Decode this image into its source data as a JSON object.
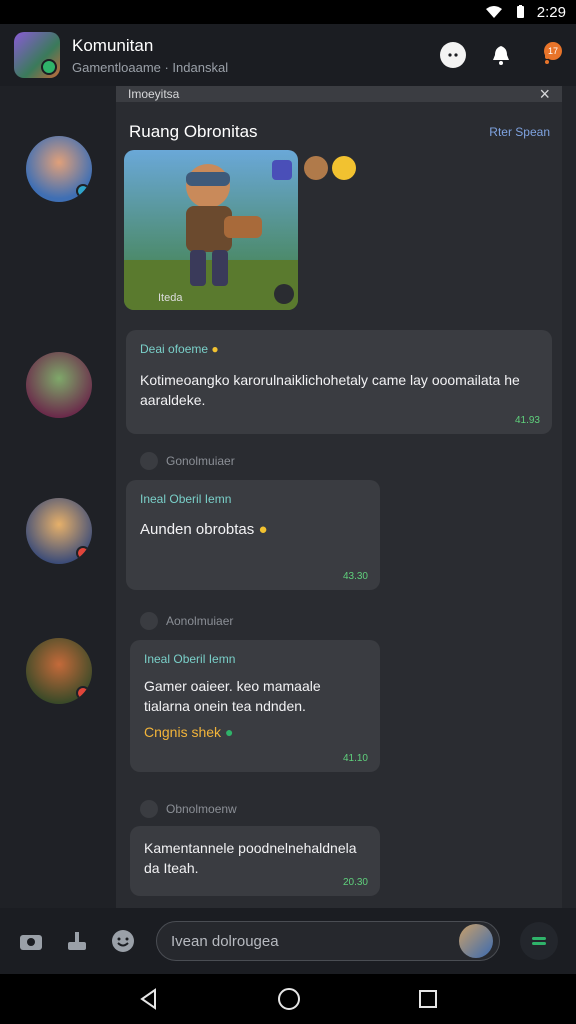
{
  "status": {
    "time": "2:29"
  },
  "header": {
    "title": "Komunitan",
    "subtitle": "Gamentloaame · Indanskal",
    "notification_count": "17"
  },
  "panel": {
    "header_label": "Imoeyitsa",
    "room_title": "Ruang Obronitas",
    "room_link": "Rter Spean",
    "image_caption": "Iteda"
  },
  "messages": [
    {
      "name": "Deai ofoeme",
      "text": "Kotimeoangko karorulnaiklichohetaly came lay ooomailata he aaraldeke.",
      "time": "41.93"
    },
    {
      "name": "Ineal Oberil Iemn",
      "text": "Aunden obrobtas",
      "time": "43.30"
    },
    {
      "name": "Ineal Oberil Iemn",
      "text": "Gamer oaieer. keo mamaale tialarna onein tea ndnden.",
      "highlight": "Cngnis shek",
      "time": "41.10"
    },
    {
      "name": "",
      "text": "Kamentannele poodnelnehaldnela da Iteah.",
      "time": "20.30"
    }
  ],
  "system_notes": [
    "Gonolmuiaer",
    "Aonolmuiaer",
    "Obnolmoenw"
  ],
  "composer": {
    "placeholder": "Ivean dolrougea"
  },
  "colors": {
    "accent": "#7ad0c9",
    "time": "#5fd07c",
    "badge": "#e8742a"
  }
}
